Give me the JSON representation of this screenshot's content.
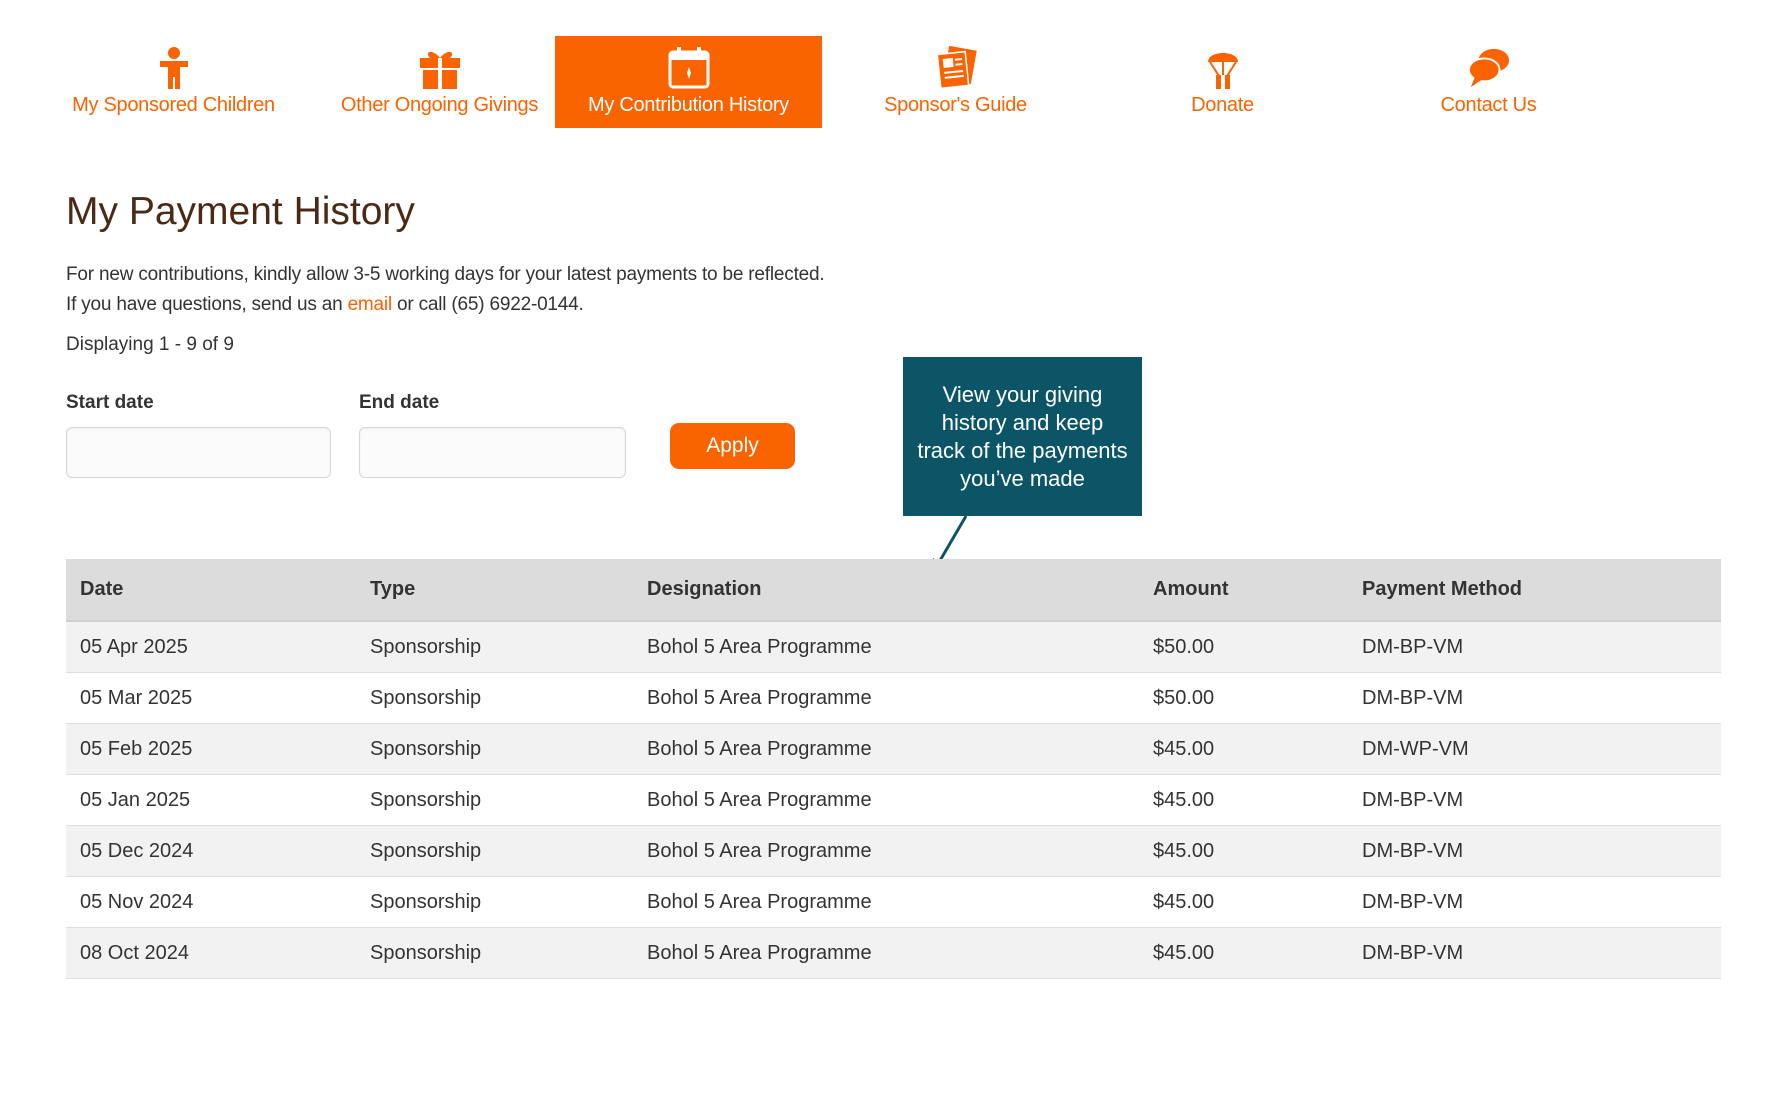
{
  "nav": {
    "items": [
      {
        "label": "My Sponsored Children",
        "icon": "child-icon"
      },
      {
        "label": "Other Ongoing Givings",
        "icon": "gift-icon"
      },
      {
        "label": "My Contribution History",
        "icon": "calendar-icon",
        "active": true
      },
      {
        "label": "Sponsor's Guide",
        "icon": "guide-book-icon"
      },
      {
        "label": "Donate",
        "icon": "donate-icon"
      },
      {
        "label": "Contact Us",
        "icon": "chat-icon"
      }
    ]
  },
  "page": {
    "title": "My Payment History",
    "intro_line1": "For new contributions, kindly allow 3-5 working days for your latest payments to be reflected.",
    "intro_line2_prefix": "If you have questions, send us an ",
    "intro_link": "email",
    "intro_line2_suffix": " or call (65) 6922-0144.",
    "display_count": "Displaying 1 - 9 of 9"
  },
  "filters": {
    "start_label": "Start date",
    "start_value": "",
    "end_label": "End date",
    "end_value": "",
    "apply_label": "Apply"
  },
  "callout": {
    "text": "View your giving history and keep track of the payments you’ve made"
  },
  "table": {
    "headers": [
      "Date",
      "Type",
      "Designation",
      "Amount",
      "Payment Method"
    ],
    "rows": [
      {
        "date": "05 Apr 2025",
        "type": "Sponsorship",
        "designation": "Bohol 5 Area Programme",
        "amount": "$50.00",
        "method": "DM-BP-VM"
      },
      {
        "date": "05 Mar 2025",
        "type": "Sponsorship",
        "designation": "Bohol 5 Area Programme",
        "amount": "$50.00",
        "method": "DM-BP-VM"
      },
      {
        "date": "05 Feb 2025",
        "type": "Sponsorship",
        "designation": "Bohol 5 Area Programme",
        "amount": "$45.00",
        "method": "DM-WP-VM"
      },
      {
        "date": "05 Jan 2025",
        "type": "Sponsorship",
        "designation": "Bohol 5 Area Programme",
        "amount": "$45.00",
        "method": "DM-BP-VM"
      },
      {
        "date": "05 Dec 2024",
        "type": "Sponsorship",
        "designation": "Bohol 5 Area Programme",
        "amount": "$45.00",
        "method": "DM-BP-VM"
      },
      {
        "date": "05 Nov 2024",
        "type": "Sponsorship",
        "designation": "Bohol 5 Area Programme",
        "amount": "$45.00",
        "method": "DM-BP-VM"
      },
      {
        "date": "08 Oct 2024",
        "type": "Sponsorship",
        "designation": "Bohol 5 Area Programme",
        "amount": "$45.00",
        "method": "DM-BP-VM"
      }
    ]
  },
  "colors": {
    "brand_orange": "#fa6400",
    "callout_teal": "#0b5566",
    "title_brown": "#4a2a14"
  }
}
